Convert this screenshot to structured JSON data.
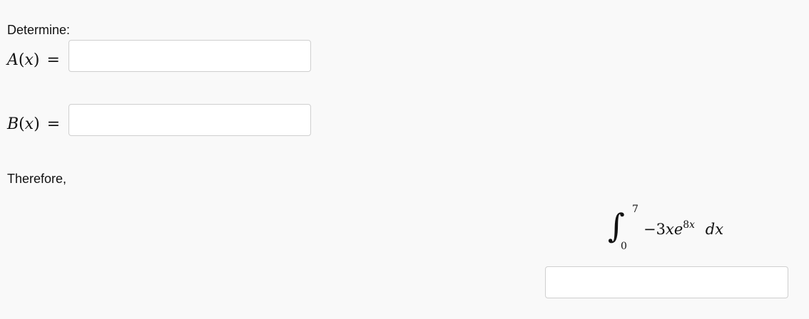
{
  "heading": "Determine:",
  "a_row": {
    "fn": "A",
    "var": "x",
    "equals": "=",
    "input_value": "",
    "input_placeholder": ""
  },
  "b_row": {
    "fn": "B",
    "var": "x",
    "equals": "=",
    "input_value": "",
    "input_placeholder": ""
  },
  "therefore_text": "Therefore,",
  "integral": {
    "sign": "∫",
    "lower_limit": "0",
    "upper_limit": "7",
    "coefficient": "−3",
    "var": "x",
    "base": "e",
    "exponent_coef": "8",
    "exponent_var": "x",
    "differential_d": "d",
    "differential_var": "x"
  },
  "result_input": {
    "value": "",
    "placeholder": ""
  }
}
